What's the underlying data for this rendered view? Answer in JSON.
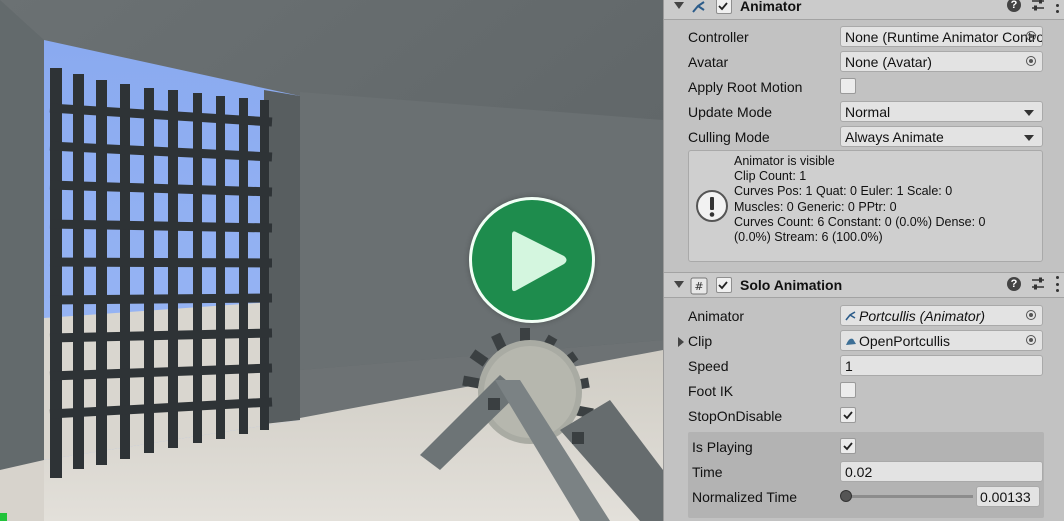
{
  "animator": {
    "title": "Animator",
    "controller_label": "Controller",
    "controller_value": "None (Runtime Animator Controller)",
    "avatar_label": "Avatar",
    "avatar_value": "None (Avatar)",
    "apply_root_motion_label": "Apply Root Motion",
    "apply_root_motion_checked": false,
    "update_mode_label": "Update Mode",
    "update_mode_value": "Normal",
    "culling_mode_label": "Culling Mode",
    "culling_mode_value": "Always Animate",
    "info_lines": [
      "Animator is visible",
      "Clip Count: 1",
      "Curves Pos: 1 Quat: 0 Euler: 1 Scale: 0",
      "Muscles: 0 Generic: 0 PPtr: 0",
      "Curves Count: 6 Constant: 0 (0.0%) Dense: 0",
      "(0.0%) Stream: 6 (100.0%)"
    ]
  },
  "solo": {
    "title": "Solo Animation",
    "animator_label": "Animator",
    "animator_value": "Portcullis (Animator)",
    "clip_label": "Clip",
    "clip_value": "OpenPortcullis",
    "speed_label": "Speed",
    "speed_value": "1",
    "foot_ik_label": "Foot IK",
    "foot_ik_checked": false,
    "stop_on_disable_label": "StopOnDisable",
    "stop_on_disable_checked": true,
    "is_playing_label": "Is Playing",
    "is_playing_checked": true,
    "time_label": "Time",
    "time_value": "0.02",
    "normalized_time_label": "Normalized Time",
    "normalized_time_value": "0.00133",
    "normalized_time_fraction": 0.00133
  },
  "icons": {
    "play_overlay": "play-icon",
    "help": "help-icon",
    "presets": "sliders-icon",
    "menu": "more-vertical-icon"
  },
  "colors": {
    "play_button": "#1e8c4d",
    "inspector_bg": "#c2c2c2",
    "sky": "#8fb0f0"
  }
}
